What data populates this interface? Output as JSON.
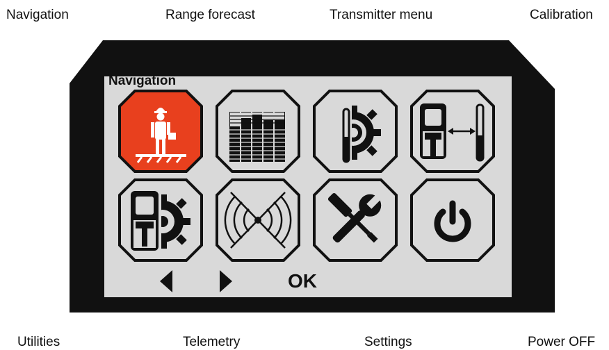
{
  "captions": {
    "navigation": "Navigation",
    "range_forecast": "Range forecast",
    "transmitter_menu": "Transmitter menu",
    "calibration": "Calibration",
    "utilities": "Utilities",
    "telemetry": "Telemetry",
    "settings": "Settings",
    "power_off": "Power OFF"
  },
  "screen": {
    "title": "Navigation",
    "ok_label": "OK",
    "selected_tile": "navigation",
    "accent_color": "#e8401e",
    "screen_bg": "#d9d9d9",
    "bezel_color": "#111111"
  },
  "tiles": [
    {
      "id": "navigation",
      "icon": "person-on-ground-icon"
    },
    {
      "id": "range_forecast",
      "icon": "signal-bars-icon"
    },
    {
      "id": "transmitter_menu",
      "icon": "transmitter-gear-icon"
    },
    {
      "id": "calibration",
      "icon": "receiver-distance-icon"
    },
    {
      "id": "utilities",
      "icon": "receiver-gear-icon"
    },
    {
      "id": "telemetry",
      "icon": "radio-waves-icon"
    },
    {
      "id": "settings",
      "icon": "wrench-screwdriver-icon"
    },
    {
      "id": "power_off",
      "icon": "power-icon"
    }
  ]
}
